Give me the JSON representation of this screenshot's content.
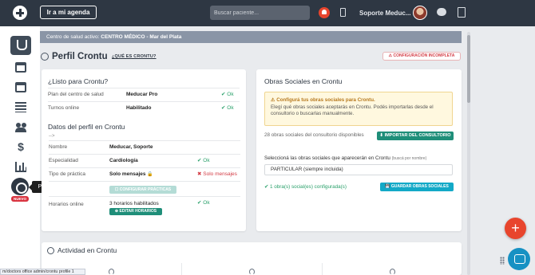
{
  "topbar": {
    "agenda_button": "Ir a mi agenda",
    "search_placeholder": "Buscar paciente...",
    "user_name": "Soporte Meduc..."
  },
  "sidebar": {
    "tooltip": "Perfil Crontu",
    "badge": "NUEVO"
  },
  "header": {
    "center_prefix": "Centro de salud activo: ",
    "center_name": "CENTRO MÉDICO - Mar del Plata",
    "title": "Perfil Crontu",
    "que_es": "¿QUÉ ES CRONTU?",
    "config_badge": "CONFIGURACIÓN INCOMPLETA"
  },
  "left_card": {
    "listo_title": "¿Listo para Crontu?",
    "rows1": [
      {
        "label": "Plan del centro de salud",
        "value": "Meducar Pro",
        "status": "Ok"
      },
      {
        "label": "Turnos online",
        "value": "Habilitado",
        "status": "Ok"
      }
    ],
    "datos_title": "Datos del perfil en Crontu",
    "arrow": "-->",
    "rows2": [
      {
        "label": "Nombre",
        "value": "Meducar, Soporte",
        "status": ""
      },
      {
        "label": "Especialidad",
        "value": "Cardiología",
        "status": "Ok"
      },
      {
        "label": "Tipo de práctica",
        "value": "Solo mensajes",
        "status": "Solo mensajes"
      }
    ],
    "configurar_btn": "CONFIGURAR PRÁCTICAS",
    "horarios_label": "Horarios online",
    "horarios_value": "3 horarios habilitados",
    "horarios_status": "Ok",
    "editar_btn": "EDITAR HORARIOS"
  },
  "right_card": {
    "title": "Obras Sociales en Crontu",
    "warn_title": "Configurá tus obras sociales para Crontu.",
    "warn_body": "Elegí qué obras sociales aceptarás en Crontu. Podés importarlas desde el consultorio o buscarlas manualmente.",
    "count_text": "28 obras sociales del consultorio disponibles",
    "import_btn": "IMPORTAR DEL CONSULTORIO",
    "select_label": "Seleccioná las obras sociales que aparecerán en Crontu",
    "select_hint": "(buscá por nombre)",
    "select_value": "PARTICULAR (siempre incluida)",
    "configured": "1 obra(s) social(es) configurada(s)",
    "save_btn": "GUARDAR OBRAS SOCIALES"
  },
  "bottom_card": {
    "title": "Actividad en Crontu"
  },
  "status_url": "m/doctors office admin/crontu profile 1",
  "colors": {
    "topbar": "#2e3743",
    "teal": "#1f8e79",
    "cyan": "#13a9c7",
    "red": "#e8452d",
    "green": "#29a06a"
  }
}
